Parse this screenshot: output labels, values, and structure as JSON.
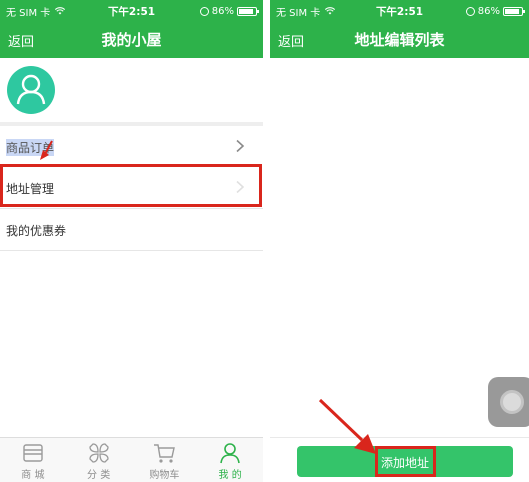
{
  "colors": {
    "brand_green": "#2db24a",
    "button_green": "#34c46a",
    "avatar_teal": "#2ec8a0",
    "highlight_red": "#d9261c"
  },
  "status_bar": {
    "carrier": "无 SIM 卡",
    "time": "下午2:51",
    "battery_label": "86%",
    "battery_level": 0.86
  },
  "left_screen": {
    "back_label": "返回",
    "title": "我的小屋",
    "menu": [
      {
        "label": "商品订单",
        "icon": "chevron-right-icon"
      },
      {
        "label": "地址管理",
        "icon": "chevron-right-icon"
      },
      {
        "label": "我的优惠券",
        "icon": ""
      }
    ],
    "tabs": [
      {
        "label": "商 城",
        "icon": "store-icon",
        "active": false
      },
      {
        "label": "分 类",
        "icon": "category-icon",
        "active": false
      },
      {
        "label": "购物车",
        "icon": "cart-icon",
        "active": false
      },
      {
        "label": "我 的",
        "icon": "profile-icon",
        "active": true
      }
    ]
  },
  "right_screen": {
    "back_label": "返回",
    "title": "地址编辑列表",
    "add_button_label": "添加地址"
  }
}
